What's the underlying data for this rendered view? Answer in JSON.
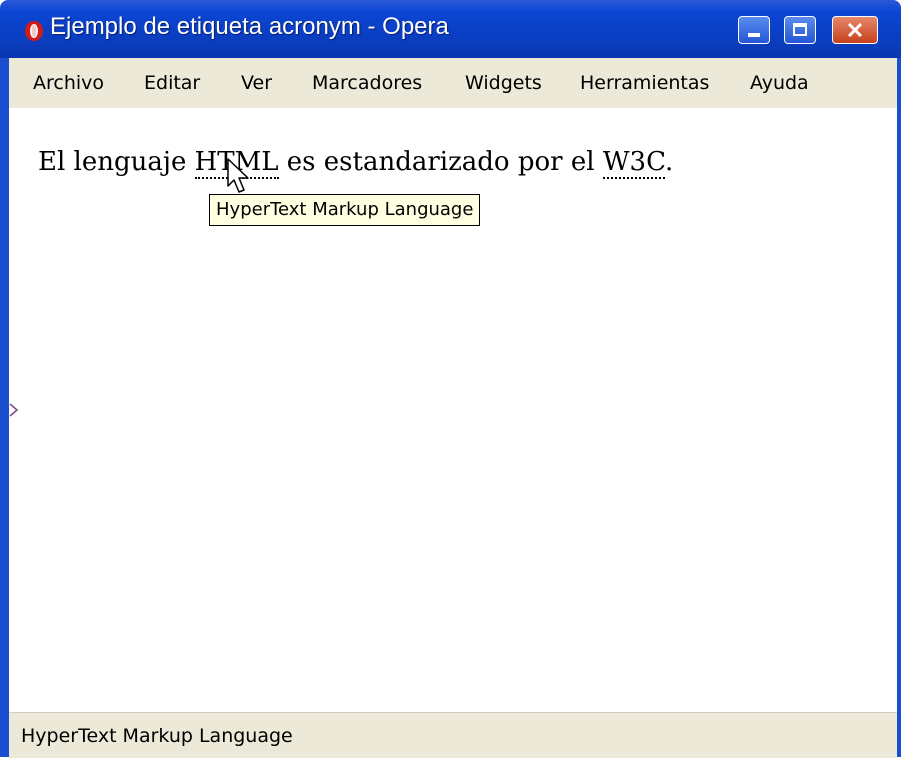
{
  "window": {
    "title": "Ejemplo de etiqueta acronym - Opera"
  },
  "menu": {
    "items": [
      {
        "label": "Archivo"
      },
      {
        "label": "Editar"
      },
      {
        "label": "Ver"
      },
      {
        "label": "Marcadores"
      },
      {
        "label": "Widgets"
      },
      {
        "label": "Herramientas"
      },
      {
        "label": "Ayuda"
      }
    ]
  },
  "content": {
    "text_before": "El lenguaje ",
    "acronym1": "HTML",
    "text_middle": " es estandarizado por el ",
    "acronym2": "W3C",
    "text_after": "."
  },
  "tooltip": {
    "text": "HyperText Markup Language"
  },
  "statusbar": {
    "text": "HyperText Markup Language"
  },
  "icons": {
    "app": "opera-icon",
    "minimize": "minimize-icon",
    "maximize": "maximize-icon",
    "close": "close-icon",
    "cursor": "mouse-pointer-icon",
    "panel_toggle": "panel-toggle-arrow-icon"
  },
  "colors": {
    "titlebar": "#0b45d2",
    "menubar": "#ece9d8",
    "tooltip_bg": "#ffffe1",
    "close_button": "#c6421d"
  }
}
